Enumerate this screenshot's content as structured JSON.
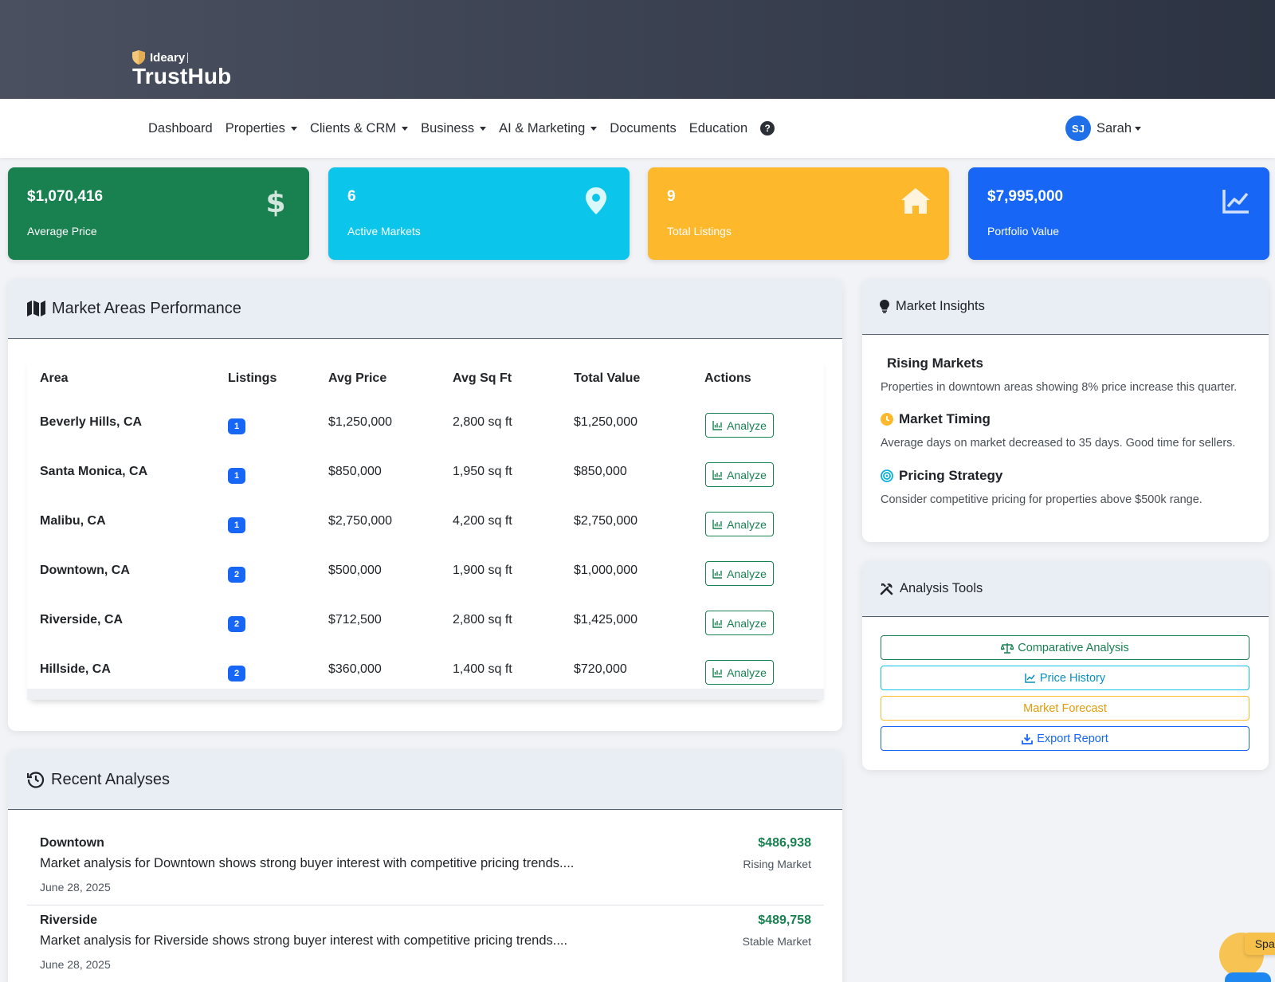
{
  "brand": {
    "top": "Ideary",
    "main": "TrustHub"
  },
  "nav": {
    "items": [
      {
        "label": "Dashboard",
        "dropdown": false
      },
      {
        "label": "Properties",
        "dropdown": true
      },
      {
        "label": "Clients & CRM",
        "dropdown": true
      },
      {
        "label": "Business",
        "dropdown": true
      },
      {
        "label": "AI & Marketing",
        "dropdown": true
      },
      {
        "label": "Documents",
        "dropdown": false
      },
      {
        "label": "Education",
        "dropdown": false
      }
    ],
    "help": "?",
    "user": {
      "initials": "SJ",
      "name": "Sarah"
    }
  },
  "stats": [
    {
      "value": "$1,070,416",
      "label": "Average Price",
      "icon": "dollar-icon",
      "color": "#198050"
    },
    {
      "value": "6",
      "label": "Active Markets",
      "icon": "map-pin-icon",
      "color": "#0bc5ea"
    },
    {
      "value": "9",
      "label": "Total Listings",
      "icon": "home-icon",
      "color": "#fdb82c"
    },
    {
      "value": "$7,995,000",
      "label": "Portfolio Value",
      "icon": "line-chart-icon",
      "color": "#1766f5"
    }
  ],
  "market": {
    "title": "Market Areas Performance",
    "columns": [
      "Area",
      "Listings",
      "Avg Price",
      "Avg Sq Ft",
      "Total Value",
      "Actions"
    ],
    "action_label": "Analyze",
    "rows": [
      {
        "area": "Beverly Hills, CA",
        "listings": "1",
        "avg_price": "$1,250,000",
        "avg_sqft": "2,800 sq ft",
        "total": "$1,250,000"
      },
      {
        "area": "Santa Monica, CA",
        "listings": "1",
        "avg_price": "$850,000",
        "avg_sqft": "1,950 sq ft",
        "total": "$850,000"
      },
      {
        "area": "Malibu, CA",
        "listings": "1",
        "avg_price": "$2,750,000",
        "avg_sqft": "4,200 sq ft",
        "total": "$2,750,000"
      },
      {
        "area": "Downtown, CA",
        "listings": "2",
        "avg_price": "$500,000",
        "avg_sqft": "1,900 sq ft",
        "total": "$1,000,000"
      },
      {
        "area": "Riverside, CA",
        "listings": "2",
        "avg_price": "$712,500",
        "avg_sqft": "2,800 sq ft",
        "total": "$1,425,000"
      },
      {
        "area": "Hillside, CA",
        "listings": "2",
        "avg_price": "$360,000",
        "avg_sqft": "1,400 sq ft",
        "total": "$720,000"
      }
    ]
  },
  "recent": {
    "title": "Recent Analyses",
    "items": [
      {
        "title": "Downtown",
        "desc": "Market analysis for Downtown shows strong buyer interest with competitive pricing trends....",
        "date": "June 28, 2025",
        "amount": "$486,938",
        "trend": "Rising Market"
      },
      {
        "title": "Riverside",
        "desc": "Market analysis for Riverside shows strong buyer interest with competitive pricing trends....",
        "date": "June 28, 2025",
        "amount": "$489,758",
        "trend": "Stable Market"
      }
    ]
  },
  "insights": {
    "title": "Market Insights",
    "items": [
      {
        "heading": "Rising Markets",
        "text": "Properties in downtown areas showing 8% price increase this quarter."
      },
      {
        "heading": "Market Timing",
        "text": "Average days on market decreased to 35 days. Good time for sellers."
      },
      {
        "heading": "Pricing Strategy",
        "text": "Consider competitive pricing for properties above $500k range."
      }
    ]
  },
  "tools": {
    "title": "Analysis Tools",
    "buttons": [
      "Comparative Analysis",
      "Price History",
      "Market Forecast",
      "Export Report"
    ]
  },
  "spark": {
    "label": "Spark"
  }
}
